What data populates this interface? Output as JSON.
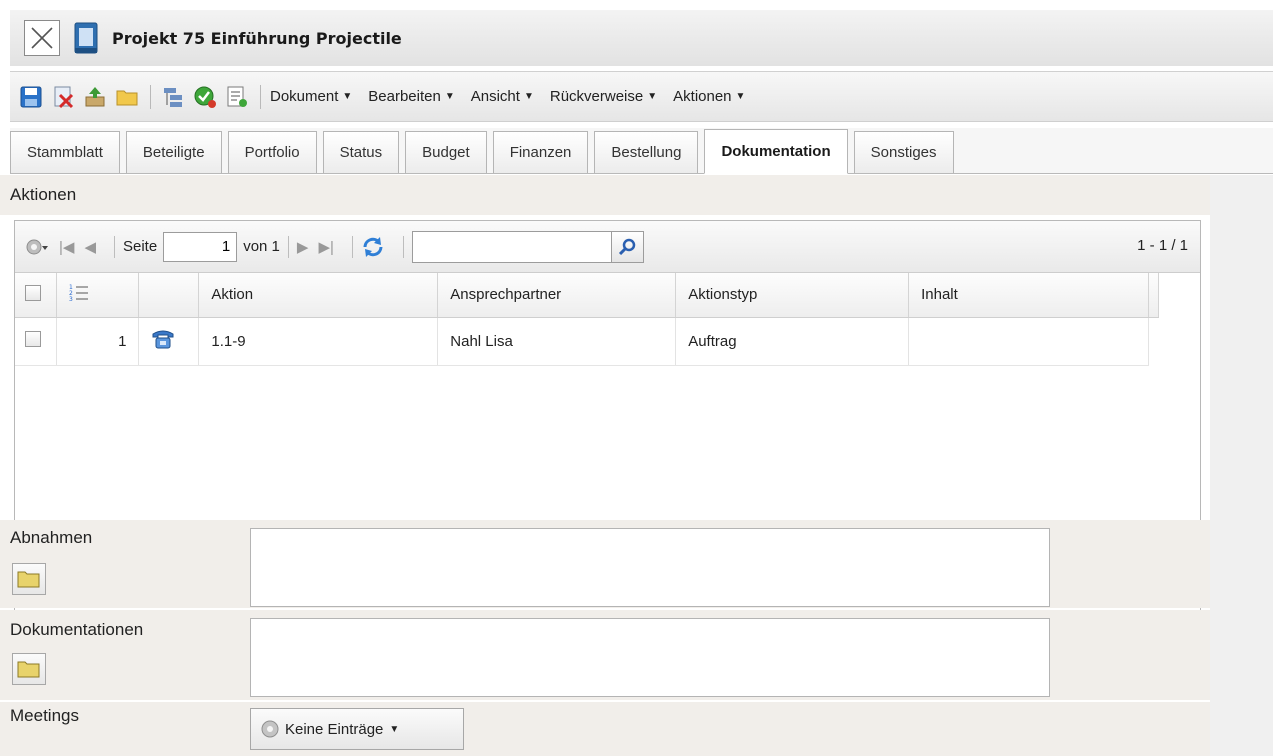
{
  "window": {
    "title": "Projekt 75 Einführung Projectile"
  },
  "toolbar": {
    "menus": [
      {
        "label": "Dokument"
      },
      {
        "label": "Bearbeiten"
      },
      {
        "label": "Ansicht"
      },
      {
        "label": "Rückverweise"
      },
      {
        "label": "Aktionen"
      }
    ]
  },
  "tabs": [
    {
      "label": "Stammblatt",
      "active": false
    },
    {
      "label": "Beteiligte",
      "active": false
    },
    {
      "label": "Portfolio",
      "active": false
    },
    {
      "label": "Status",
      "active": false
    },
    {
      "label": "Budget",
      "active": false
    },
    {
      "label": "Finanzen",
      "active": false
    },
    {
      "label": "Bestellung",
      "active": false
    },
    {
      "label": "Dokumentation",
      "active": true
    },
    {
      "label": "Sonstiges",
      "active": false
    }
  ],
  "aktionen": {
    "label": "Aktionen",
    "pager": {
      "page_label": "Seite",
      "page_value": "1",
      "of_label": "von 1",
      "search_value": "",
      "count": "1 - 1 / 1"
    },
    "columns": {
      "aktion": "Aktion",
      "ansprechpartner": "Ansprechpartner",
      "aktionstyp": "Aktionstyp",
      "inhalt": "Inhalt"
    },
    "rows": [
      {
        "num": "1",
        "aktion": "1.1-9",
        "ansprechpartner": "Nahl Lisa",
        "aktionstyp": "Auftrag",
        "inhalt": ""
      }
    ]
  },
  "abnahmen": {
    "label": "Abnahmen"
  },
  "dokumentationen": {
    "label": "Dokumentationen"
  },
  "meetings": {
    "label": "Meetings",
    "dropdown_label": "Keine Einträge"
  },
  "colors": {
    "section_bg": "#f1eeea",
    "toolbar_bg": "#e9e9e9",
    "border": "#b8b8b8"
  }
}
